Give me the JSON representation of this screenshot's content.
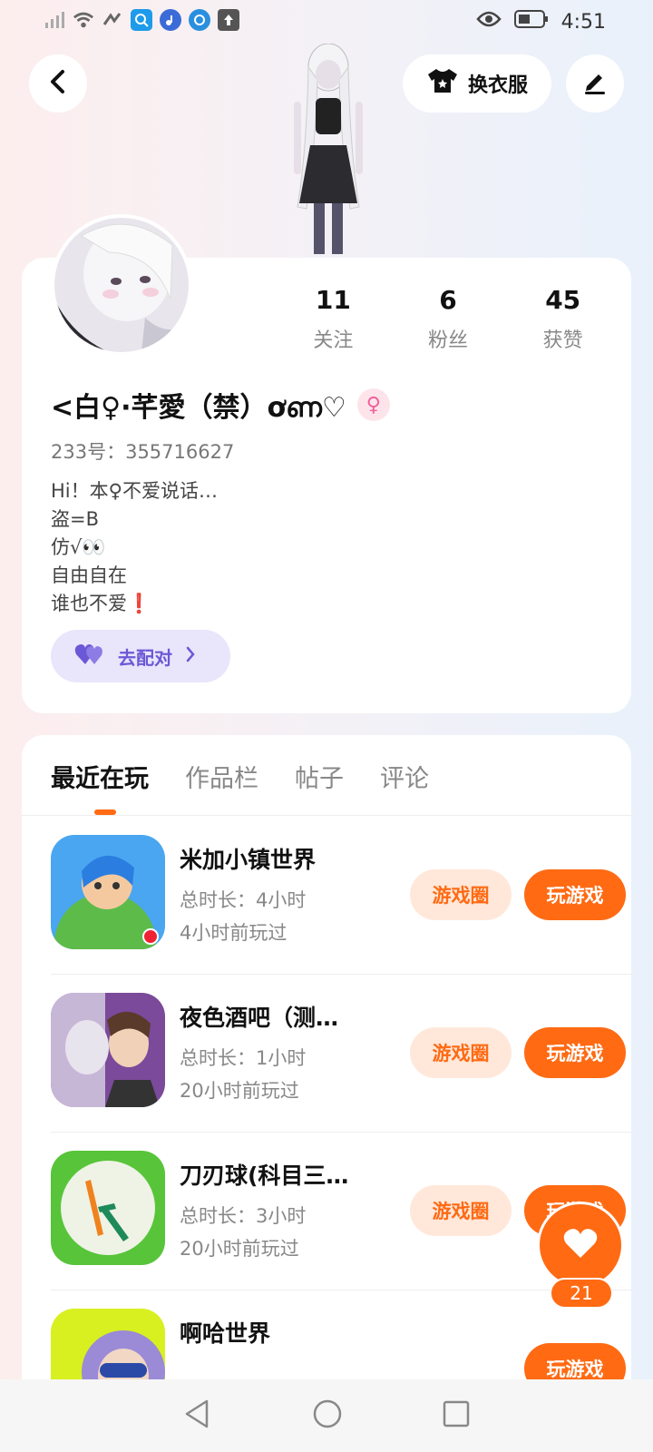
{
  "status_bar": {
    "time": "4:51",
    "icons": [
      "signal-icon",
      "wifi-icon",
      "nfc-icon",
      "search-app-icon",
      "music-app-icon",
      "browser-app-icon",
      "upload-icon",
      "eye-icon",
      "battery-icon"
    ]
  },
  "header": {
    "dress_label": "换衣服"
  },
  "profile": {
    "stats": [
      {
        "num": "11",
        "label": "关注"
      },
      {
        "num": "6",
        "label": "粉丝"
      },
      {
        "num": "45",
        "label": "获赞"
      }
    ],
    "nickname": "<白♀·芊愛（禁）ơണ♡",
    "gender_symbol": "♀",
    "uid": "233号：355716627",
    "bio_lines": [
      "Hi！本♀不爱说话…",
      "盗=B",
      "仿√👀",
      "自由自在",
      "谁也不爱❗"
    ],
    "match_label": "去配对",
    "colors": {
      "accent": "#ff6a13",
      "match": "#6b58d6"
    }
  },
  "tabs": [
    "最近在玩",
    "作品栏",
    "帖子",
    "评论"
  ],
  "games": [
    {
      "title": "米加小镇世界",
      "time": "总时长：4小时",
      "ago": "4小时前玩过",
      "circle": "游戏圈",
      "play": "玩游戏"
    },
    {
      "title": "夜色酒吧（测…",
      "time": "总时长：1小时",
      "ago": "20小时前玩过",
      "circle": "游戏圈",
      "play": "玩游戏"
    },
    {
      "title": "刀刃球(科目三…",
      "time": "总时长：3小时",
      "ago": "20小时前玩过",
      "circle": "游戏圈",
      "play": "玩游戏"
    },
    {
      "title": "啊哈世界",
      "time": "",
      "ago": "",
      "circle": "",
      "play": "玩游戏"
    }
  ],
  "like": {
    "count": "21"
  }
}
